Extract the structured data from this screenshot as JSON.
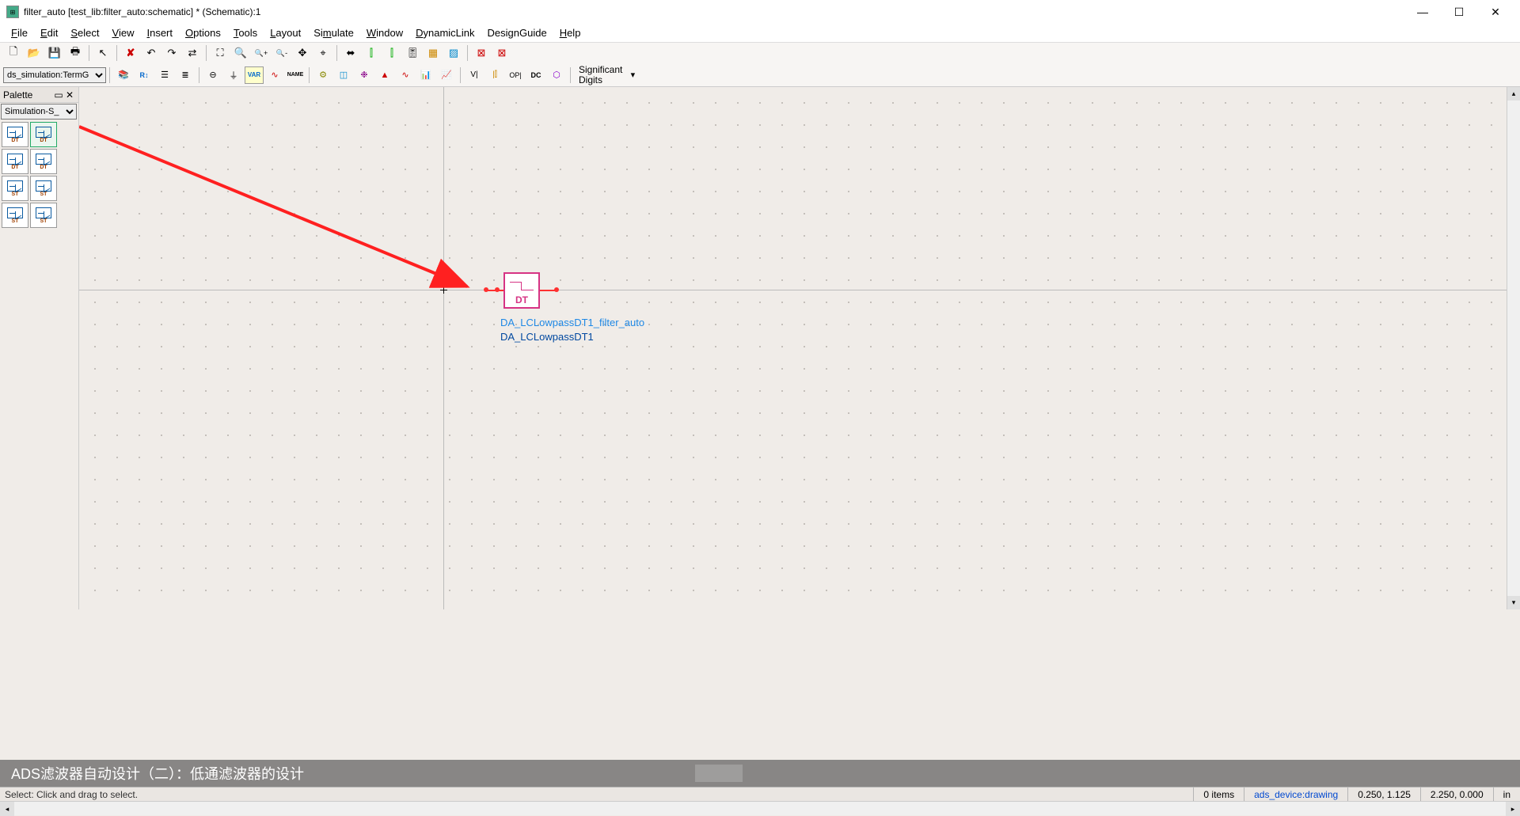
{
  "window": {
    "title": "filter_auto [test_lib:filter_auto:schematic] * (Schematic):1"
  },
  "menu": {
    "file": "File",
    "edit": "Edit",
    "select": "Select",
    "view": "View",
    "insert": "Insert",
    "options": "Options",
    "tools": "Tools",
    "layout": "Layout",
    "simulate": "Simulate",
    "window": "Window",
    "dynamiclink": "DynamicLink",
    "designguide": "DesignGuide",
    "help": "Help"
  },
  "toolbar2": {
    "component_selector": "ds_simulation:TermG",
    "sig_digits": "Significant\nDigits"
  },
  "palette": {
    "title": "Palette",
    "category": "Simulation-S_",
    "items": [
      {
        "label": "DT"
      },
      {
        "label": "DT"
      },
      {
        "label": "DT"
      },
      {
        "label": "DT"
      },
      {
        "label": "ST"
      },
      {
        "label": "ST"
      },
      {
        "label": "ST"
      },
      {
        "label": "ST"
      }
    ]
  },
  "canvas": {
    "component": {
      "inner_label": "DT",
      "name_ref": "DA_LCLowpassDT1_filter_auto",
      "name_inst": "DA_LCLowpassDT1"
    }
  },
  "overlay": {
    "caption": "ADS滤波器自动设计（二）：低通滤波器的设计"
  },
  "status": {
    "msg": "Select: Click and drag to select.",
    "items": "0 items",
    "layer": "ads_device:drawing",
    "coord1": "0.250, 1.125",
    "coord2": "2.250, 0.000",
    "units": "in"
  },
  "icons": {
    "new": "🗋",
    "open": "📂",
    "save": "💾",
    "print": "🖶",
    "pointer": "↖",
    "delete": "✘",
    "undo": "↶",
    "redo": "↷",
    "swap": "⇄",
    "zoom_fit": "⛶",
    "zoom_in": "🔍+",
    "zoom_in2": "🔍",
    "zoom_out": "🔍-",
    "pan": "✥",
    "origin": "⌖",
    "push1": "⬌",
    "push2": "⫿",
    "push3": "⫿",
    "tune": "🎚",
    "deact": "▦",
    "short": "▨",
    "oscope": "∿",
    "osc2": "∿",
    "deact2": "⊠",
    "short2": "⊠",
    "lib": "📚",
    "ruler": "R↕",
    "hist": "☰",
    "list": "≣",
    "ground": "⏚",
    "var": "VAR",
    "wire": "∿",
    "name": "NAME",
    "gear": "⚙",
    "chip": "◫",
    "bug": "❉",
    "warn": "▲",
    "sp": "∿",
    "graph": "📊",
    "plot": "📈",
    "vi": "V|",
    "vii": "|⫿",
    "opi": "OP|",
    "dc": "DC",
    "clr": "⬡"
  }
}
